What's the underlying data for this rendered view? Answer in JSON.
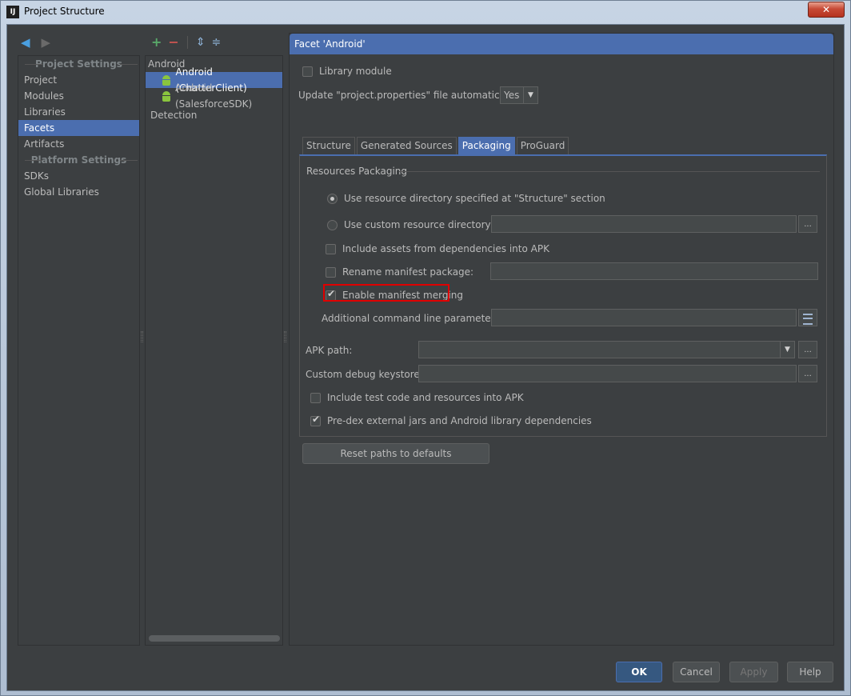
{
  "window": {
    "title": "Project Structure",
    "app_icon": "IJ",
    "close_label": "✕"
  },
  "nav": {
    "back_icon": "arrow-left-icon",
    "forward_icon": "arrow-right-icon"
  },
  "left": {
    "project_settings_header": "Project Settings",
    "project_items": [
      "Project",
      "Modules",
      "Libraries",
      "Facets",
      "Artifacts"
    ],
    "selected": "Facets",
    "platform_settings_header": "Platform Settings",
    "platform_items": [
      "SDKs",
      "Global Libraries"
    ]
  },
  "middle": {
    "group": "Android",
    "items": [
      "Android (ChatterClient)",
      "Android (SalesforceSDK)"
    ],
    "selected": "Android (ChatterClient)",
    "detection": "Detection"
  },
  "facet": {
    "header": "Facet 'Android'",
    "library_module": {
      "label": "Library module",
      "checked": false
    },
    "update_properties": {
      "label": "Update \"project.properties\" file automatically:",
      "value": "Yes"
    },
    "tabs": [
      "Structure",
      "Generated Sources",
      "Packaging",
      "ProGuard"
    ],
    "active_tab": "Packaging",
    "packaging": {
      "group_title": "Resources Packaging",
      "use_resource_dir_structure": {
        "label": "Use resource directory specified at \"Structure\" section",
        "selected": true
      },
      "use_custom_resource_dir": {
        "label": "Use custom resource directory:",
        "selected": false,
        "value": ""
      },
      "include_assets": {
        "label": "Include assets from dependencies into APK",
        "checked": false
      },
      "rename_manifest_package": {
        "label": "Rename manifest package:",
        "checked": false,
        "value": ""
      },
      "enable_manifest_merging": {
        "label": "Enable manifest merging",
        "checked": true
      },
      "additional_params": {
        "label": "Additional command line parameters:",
        "value": ""
      },
      "apk_path": {
        "label": "APK path:",
        "value": ""
      },
      "custom_debug_keystore": {
        "label": "Custom debug keystore:",
        "value": ""
      },
      "include_test_code": {
        "label": "Include test code and resources into APK",
        "checked": false
      },
      "pre_dex": {
        "label": "Pre-dex external jars and Android library dependencies",
        "checked": true
      }
    },
    "reset_paths": "Reset paths to defaults",
    "browse_label": "..."
  },
  "buttons": {
    "ok": "OK",
    "cancel": "Cancel",
    "apply": "Apply",
    "help": "Help"
  },
  "colors": {
    "selection": "#4b6eaf",
    "background": "#3c3f41",
    "highlight": "#e00000"
  }
}
